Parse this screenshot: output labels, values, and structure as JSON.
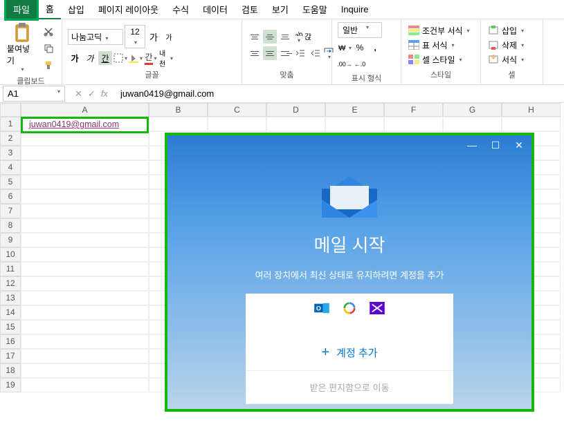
{
  "ribbon": {
    "tabs": [
      "파일",
      "홈",
      "삽입",
      "페이지 레이아웃",
      "수식",
      "데이터",
      "검토",
      "보기",
      "도움말",
      "Inquire"
    ],
    "clipboard": {
      "paste": "붙여넣기",
      "label": "클립보드"
    },
    "font": {
      "name": "나눔고딕",
      "size": "12",
      "increase": "가",
      "decrease": "가",
      "bold": "가",
      "italic": "가",
      "underline": "간",
      "text_accent": "내천",
      "label": "글꼴"
    },
    "align": {
      "wrap": "갅",
      "merge": "병",
      "label": "맞춤"
    },
    "number": {
      "format": "일반",
      "label": "표시 형식"
    },
    "style": {
      "cond": "조건부 서식",
      "table": "표 서식",
      "cell": "셀 스타일",
      "label": "스타일"
    },
    "cells": {
      "insert": "삽입",
      "delete": "삭제",
      "format": "서식",
      "label": "셀"
    }
  },
  "namebox": "A1",
  "formula": "juwan0419@gmail.com",
  "columns": [
    "A",
    "B",
    "C",
    "D",
    "E",
    "F",
    "G",
    "H"
  ],
  "rows": [
    "1",
    "2",
    "3",
    "4",
    "5",
    "6",
    "7",
    "8",
    "9",
    "10",
    "11",
    "12",
    "13",
    "14",
    "15",
    "16",
    "17",
    "18",
    "19"
  ],
  "cell_a1": "juwan0419@gmail.com",
  "mail": {
    "title": "메일 시작",
    "subtitle": "여러 장치에서 최신 상태로 유지하려면 계정을 추가",
    "add_account": "계정 추가",
    "goto_inbox": "받은 편지함으로 이동"
  }
}
